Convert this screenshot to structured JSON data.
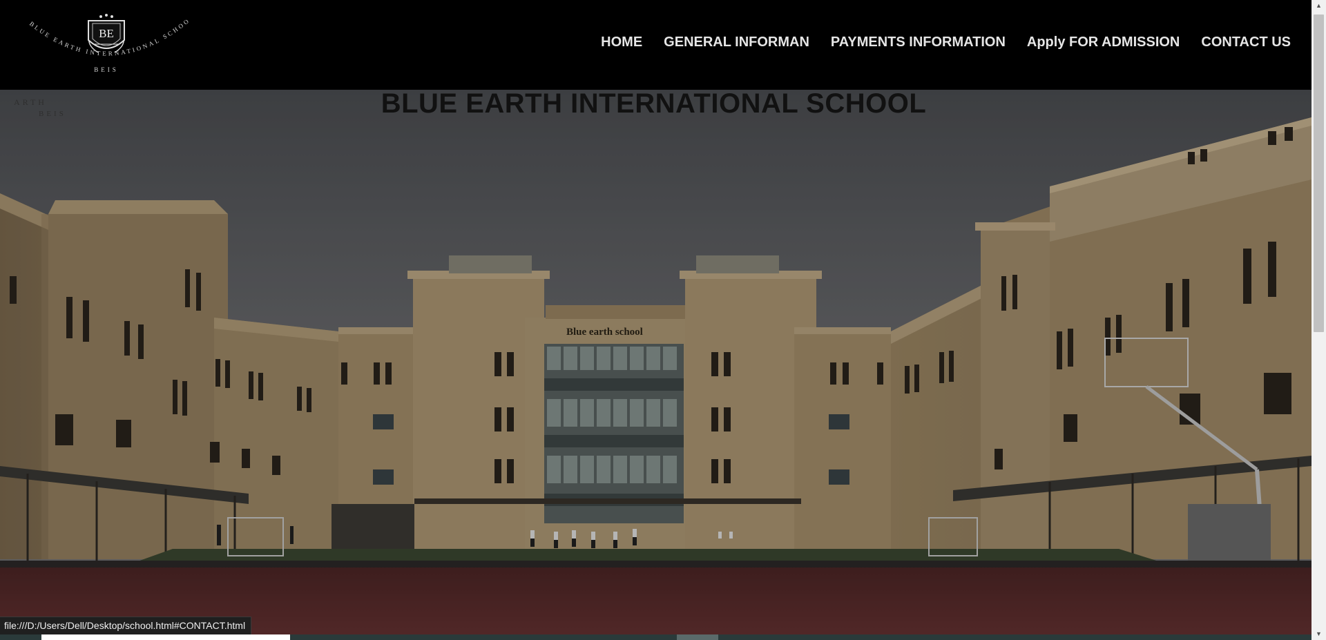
{
  "logo": {
    "initials": "BE",
    "arc_text": "BLUE EARTH INTERNATIONAL SCHOOL",
    "abbr": "BEIS"
  },
  "nav": {
    "items": [
      {
        "label": "HOME"
      },
      {
        "label": "GENERAL INFORMAN"
      },
      {
        "label": "PAYMENTS INFORMATION"
      },
      {
        "label": "Apply FOR ADMISSION"
      },
      {
        "label": "CONTACT US"
      }
    ]
  },
  "hero": {
    "title": "BLUE EARTH INTERNATIONAL SCHOOL",
    "building_sign": "Blue earth school"
  },
  "status_bar": {
    "url": "file:///D:/Users/Dell/Desktop/school.html#CONTACT.html"
  },
  "colors": {
    "header_bg": "#000000",
    "nav_text": "#e6e6e6",
    "title_text": "#111111",
    "building": "#a8916e",
    "court": "#5e2c2c",
    "sky": "#6a6b6d"
  }
}
